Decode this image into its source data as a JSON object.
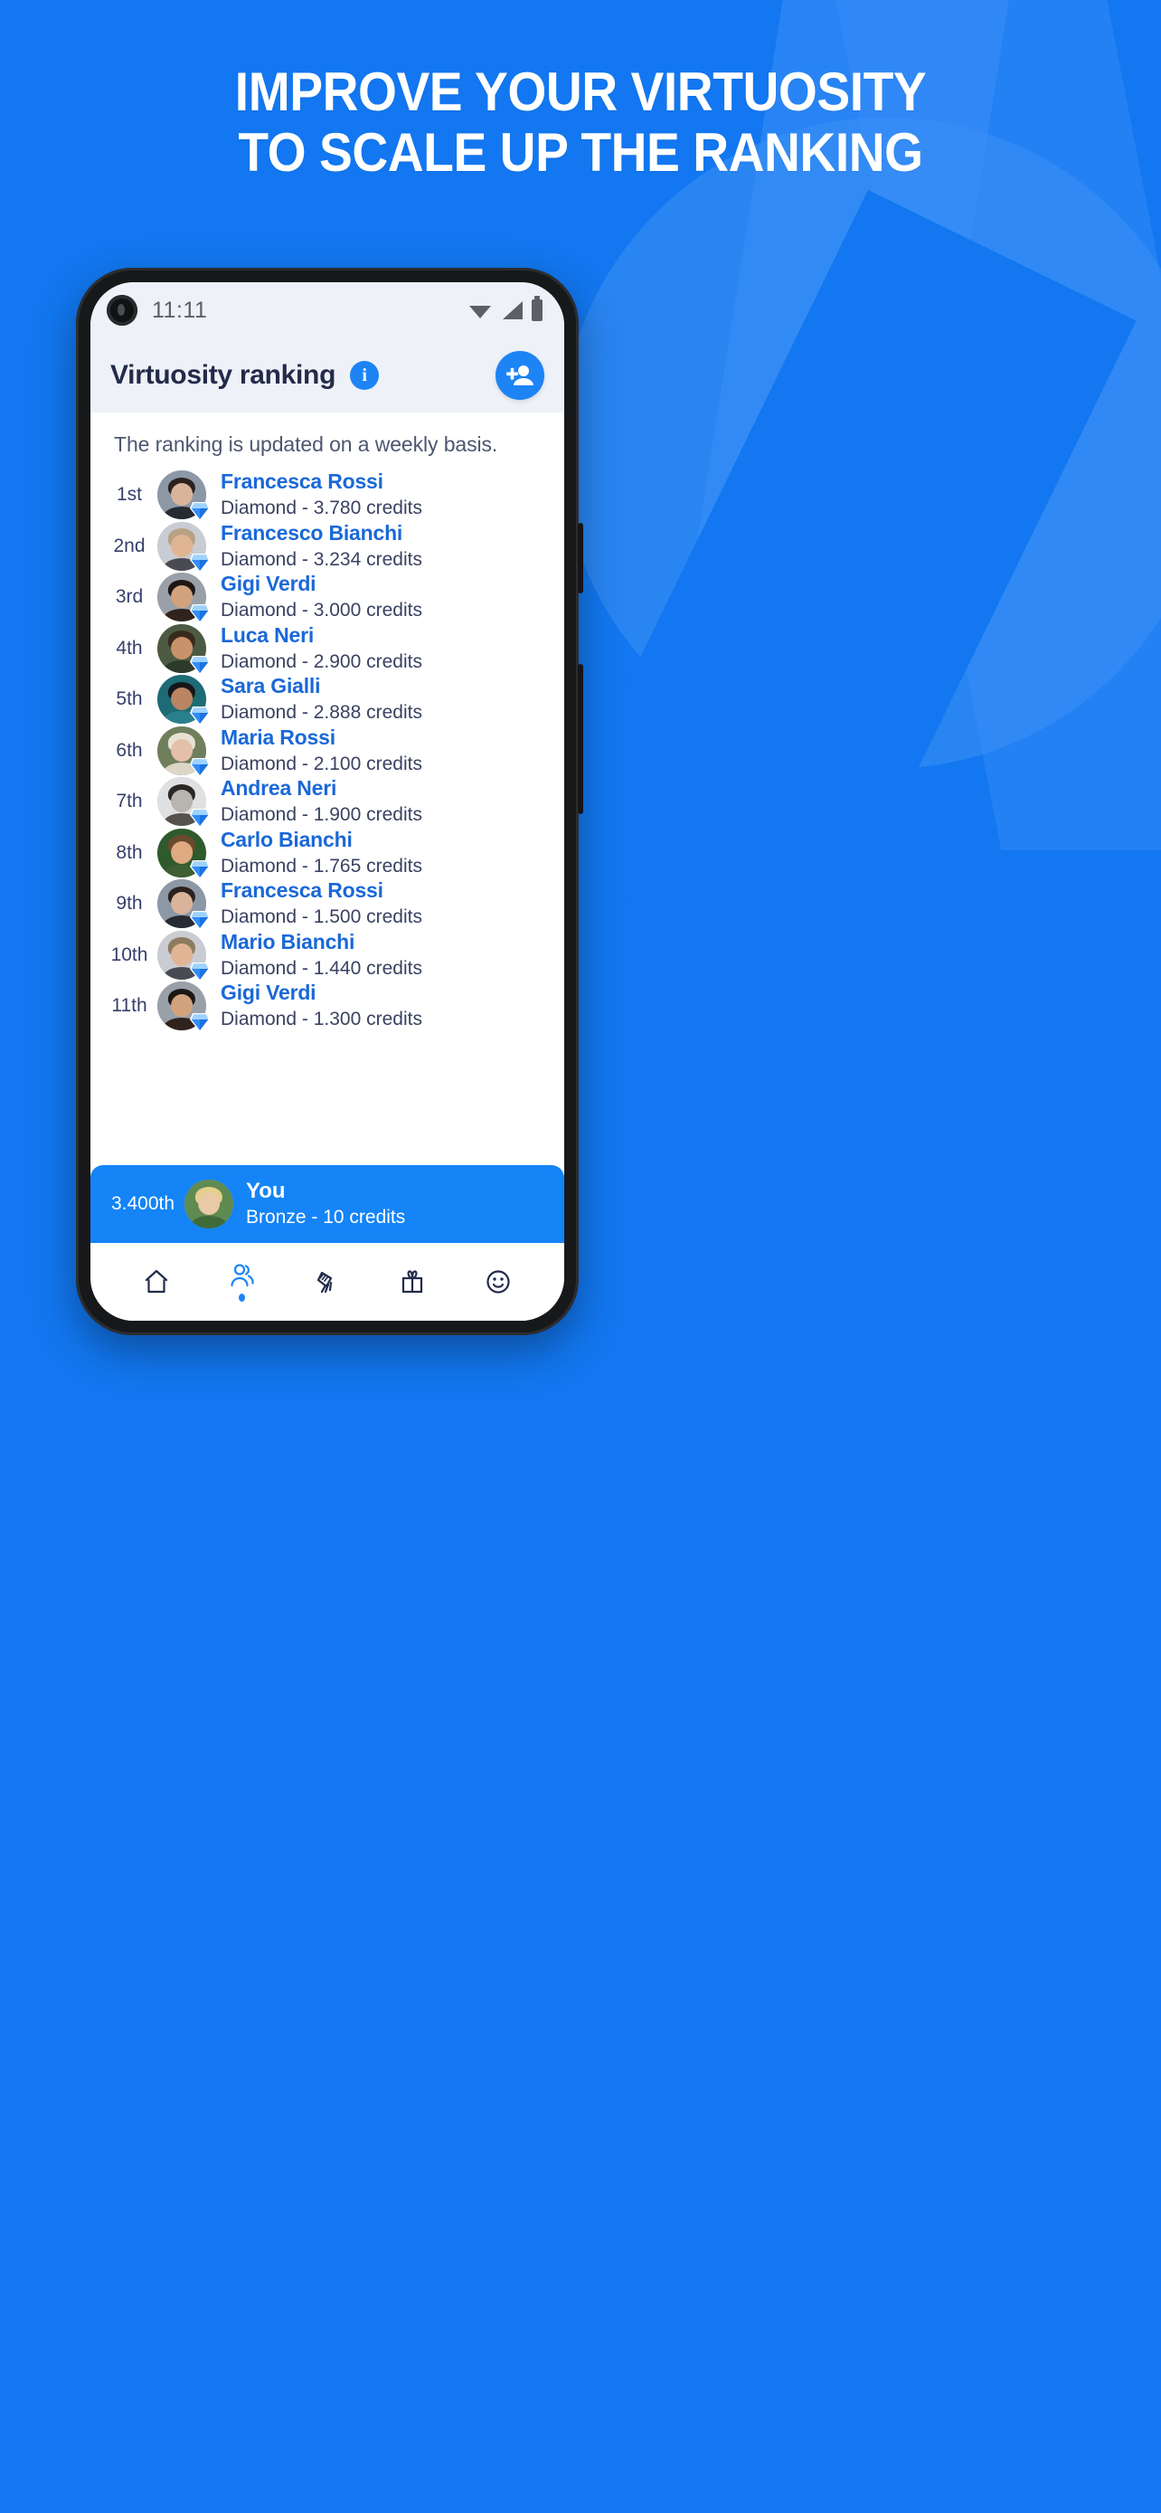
{
  "promo": {
    "headline_line1": "IMPROVE YOUR VIRTUOSITY",
    "headline_line2": "TO SCALE UP THE RANKING",
    "background_color": "#1277f0",
    "headline_color": "#ffffff"
  },
  "status_bar": {
    "time": "11:11",
    "icons": [
      "wifi-icon",
      "cellular-signal-icon",
      "battery-icon"
    ]
  },
  "app_bar": {
    "title": "Virtuosity ranking",
    "info_icon": "info-icon",
    "info_glyph": "i",
    "add_friend_icon": "add-person-icon",
    "accent_color": "#1d84f5"
  },
  "ranking": {
    "subtitle": "The ranking is updated on a weekly basis.",
    "name_color": "#1a68d8",
    "rows": [
      {
        "position": "1st",
        "name": "Francesca Rossi",
        "detail": "Diamond - 3.780 credits",
        "badge": "diamond-badge-icon",
        "skin": "#d9b49a",
        "hair": "#2b2220",
        "bg": "#8d98a6",
        "cloth": "#262b33"
      },
      {
        "position": "2nd",
        "name": "Francesco Bianchi",
        "detail": "Diamond - 3.234 credits",
        "badge": "diamond-badge-icon",
        "skin": "#e0b593",
        "hair": "#b9a183",
        "bg": "#c9ccd2",
        "cloth": "#4a4a52"
      },
      {
        "position": "3rd",
        "name": "Gigi Verdi",
        "detail": "Diamond - 3.000 credits",
        "badge": "diamond-badge-icon",
        "skin": "#d2a27c",
        "hair": "#1d1714",
        "bg": "#9aa0a8",
        "cloth": "#30231d"
      },
      {
        "position": "4th",
        "name": "Luca Neri",
        "detail": "Diamond - 2.900 credits",
        "badge": "diamond-badge-icon",
        "skin": "#c9926a",
        "hair": "#3a2a1e",
        "bg": "#4d5a43",
        "cloth": "#2c3a2a"
      },
      {
        "position": "5th",
        "name": "Sara Gialli",
        "detail": "Diamond - 2.888 credits",
        "badge": "diamond-badge-icon",
        "skin": "#b98563",
        "hair": "#16161a",
        "bg": "#1d6b74",
        "cloth": "#2a7f8c"
      },
      {
        "position": "6th",
        "name": "Maria Rossi",
        "detail": "Diamond - 2.100 credits",
        "badge": "diamond-badge-icon",
        "skin": "#e4c0a8",
        "hair": "#e8e2d4",
        "bg": "#6f7f5c",
        "cloth": "#ddd6c6"
      },
      {
        "position": "7th",
        "name": "Andrea Neri",
        "detail": "Diamond - 1.900 credits",
        "badge": "diamond-badge-icon",
        "skin": "#b8b4ae",
        "hair": "#2a2724",
        "bg": "#dfe0e2",
        "cloth": "#55514c"
      },
      {
        "position": "8th",
        "name": "Carlo Bianchi",
        "detail": "Diamond - 1.765 credits",
        "badge": "diamond-badge-icon",
        "skin": "#dfa982",
        "hair": "#6a4a2c",
        "bg": "#2f5a2c",
        "cloth": "#3d5f33"
      },
      {
        "position": "9th",
        "name": "Francesca Rossi",
        "detail": "Diamond - 1.500 credits",
        "badge": "diamond-badge-icon",
        "skin": "#d9b49a",
        "hair": "#2b2220",
        "bg": "#8d98a6",
        "cloth": "#262b33"
      },
      {
        "position": "10th",
        "name": "Mario Bianchi",
        "detail": "Diamond - 1.440 credits",
        "badge": "diamond-badge-icon",
        "skin": "#e0b593",
        "hair": "#8d7a5f",
        "bg": "#c9ccd2",
        "cloth": "#4a4a52"
      },
      {
        "position": "11th",
        "name": "Gigi Verdi",
        "detail": "Diamond - 1.300 credits",
        "badge": "diamond-badge-icon",
        "skin": "#d2a27c",
        "hair": "#1d1714",
        "bg": "#9aa0a8",
        "cloth": "#30231d"
      }
    ],
    "you": {
      "position": "3.400th",
      "name": "You",
      "detail": "Bronze - 10 credits",
      "background_color": "#1484f7",
      "skin": "#eac9a6",
      "hair": "#e4d08c",
      "bg": "#5f8a52",
      "cloth": "#3f6b3a"
    }
  },
  "bottom_nav": {
    "active_index": 1,
    "active_color": "#1d84f5",
    "inactive_color": "#232b4a",
    "items": [
      {
        "icon": "home-icon",
        "label": "Home"
      },
      {
        "icon": "people-icon",
        "label": "Community"
      },
      {
        "icon": "handshake-icon",
        "label": "Deals"
      },
      {
        "icon": "gift-icon",
        "label": "Rewards"
      },
      {
        "icon": "smiley-icon",
        "label": "Profile"
      }
    ]
  }
}
